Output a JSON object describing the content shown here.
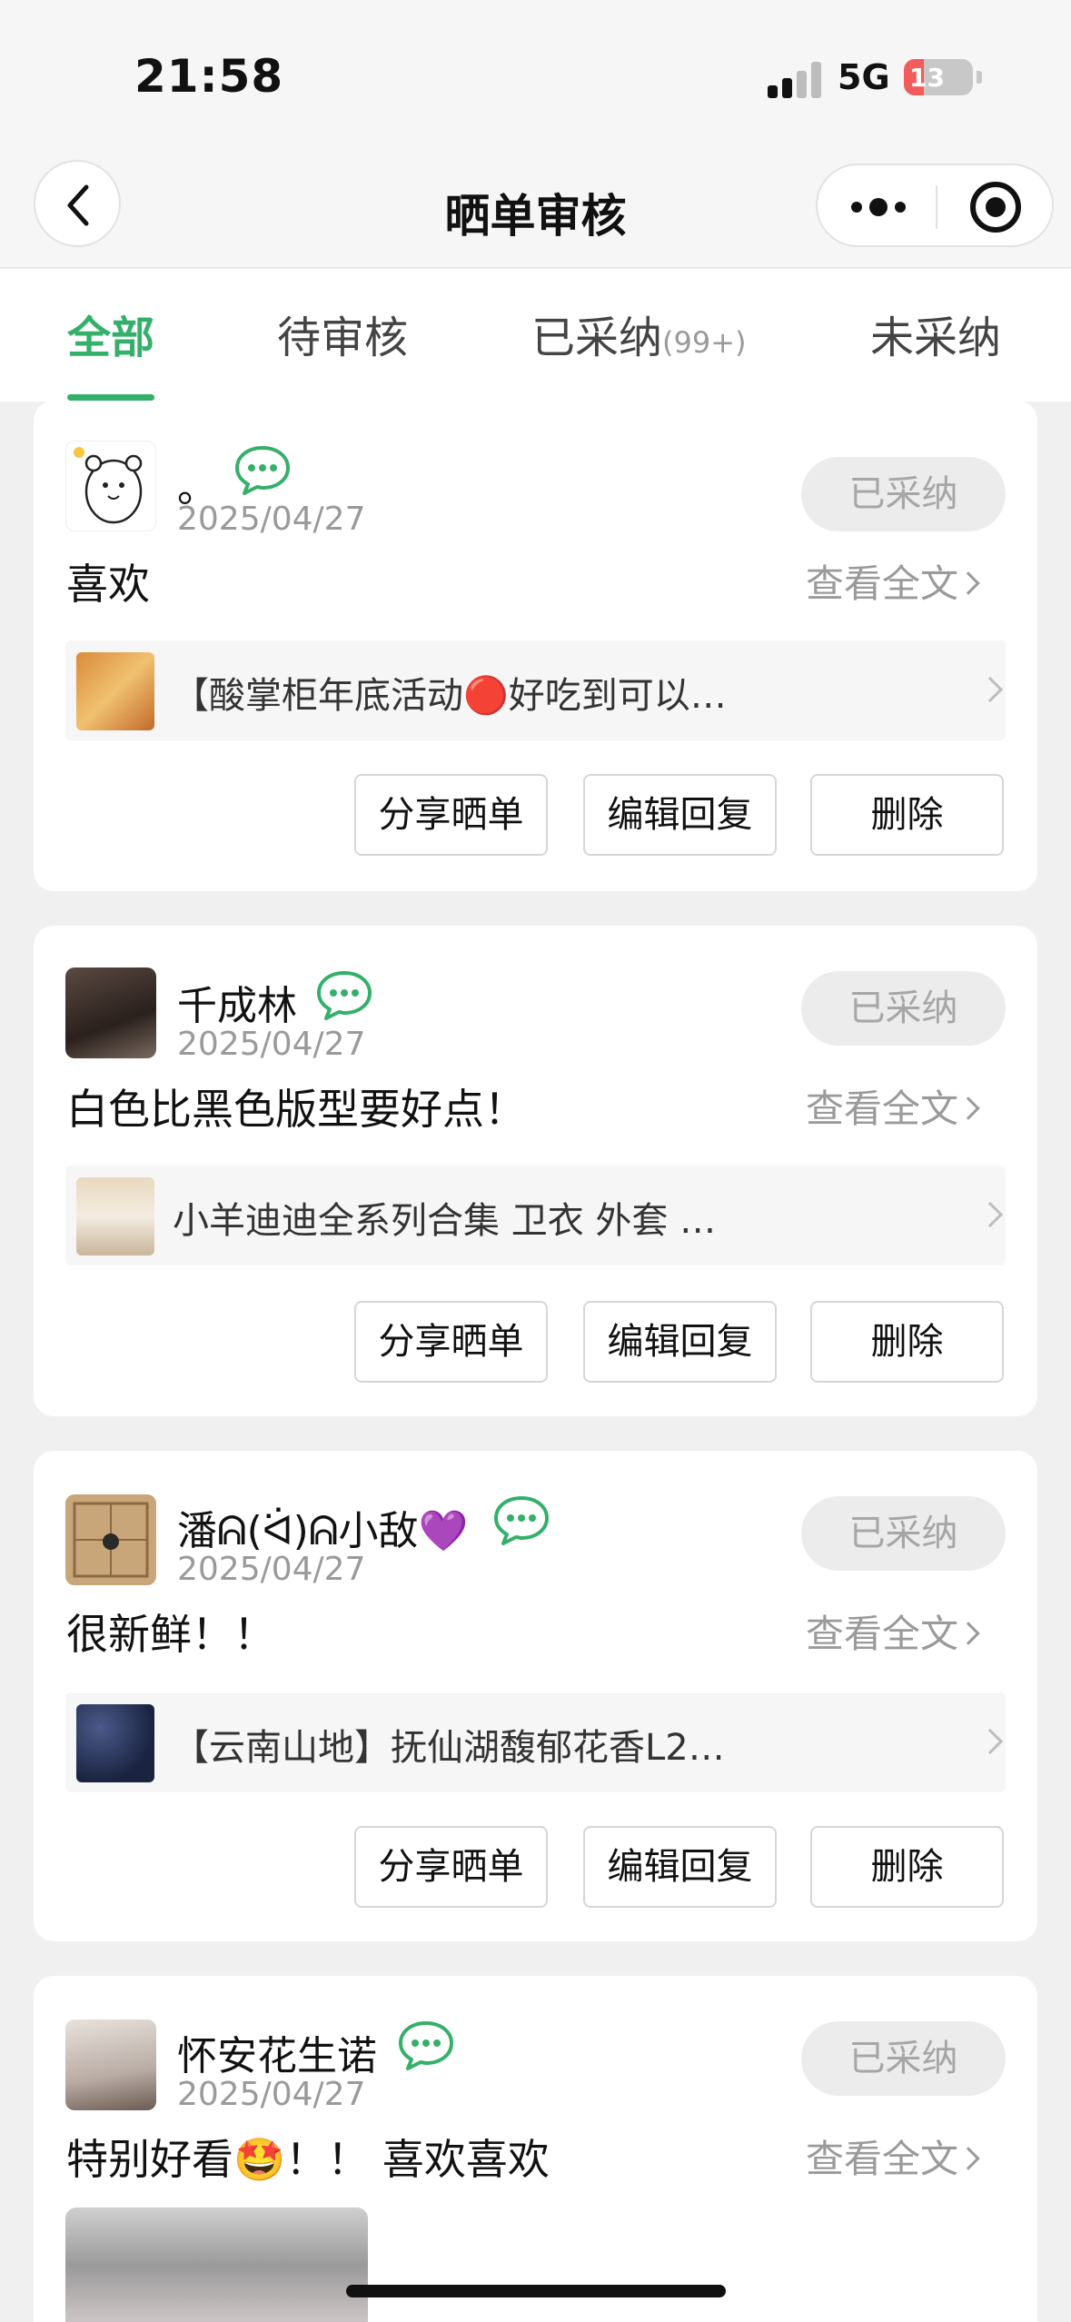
{
  "status_bar": {
    "time": "21:58",
    "network": "5G",
    "battery": "13",
    "battery_level": 0.13
  },
  "nav": {
    "title": "晒单审核"
  },
  "tabs": [
    {
      "label": "全部",
      "count": ""
    },
    {
      "label": "待审核",
      "count": ""
    },
    {
      "label": "已采纳",
      "count": "(99+)"
    },
    {
      "label": "未采纳",
      "count": ""
    }
  ],
  "common": {
    "view_full": "查看全文",
    "share": "分享晒单",
    "edit_reply": "编辑回复",
    "delete": "删除"
  },
  "reviews": [
    {
      "username": "。",
      "date": "2025/04/27",
      "status": "已采纳",
      "comment": "喜欢",
      "product": "【酸掌柜年底活动🔴好吃到可以…"
    },
    {
      "username": "千成林",
      "date": "2025/04/27",
      "status": "已采纳",
      "comment": "白色比黑色版型要好点！",
      "product": "小羊迪迪全系列合集 卫衣 外套 …"
    },
    {
      "username": "潘ᕱ(ᐛ)ᕱ小敌💜",
      "date": "2025/04/27",
      "status": "已采纳",
      "comment": "很新鲜！！",
      "product": "【云南山地】抚仙湖馥郁花香L2…"
    },
    {
      "username": "怀安花生诺",
      "date": "2025/04/27",
      "status": "已采纳",
      "comment": "特别好看🤩！！ 喜欢喜欢",
      "product": ""
    }
  ],
  "colors": {
    "accent": "#34b06b",
    "background": "#f0f0f0",
    "pill": "#ececec"
  }
}
